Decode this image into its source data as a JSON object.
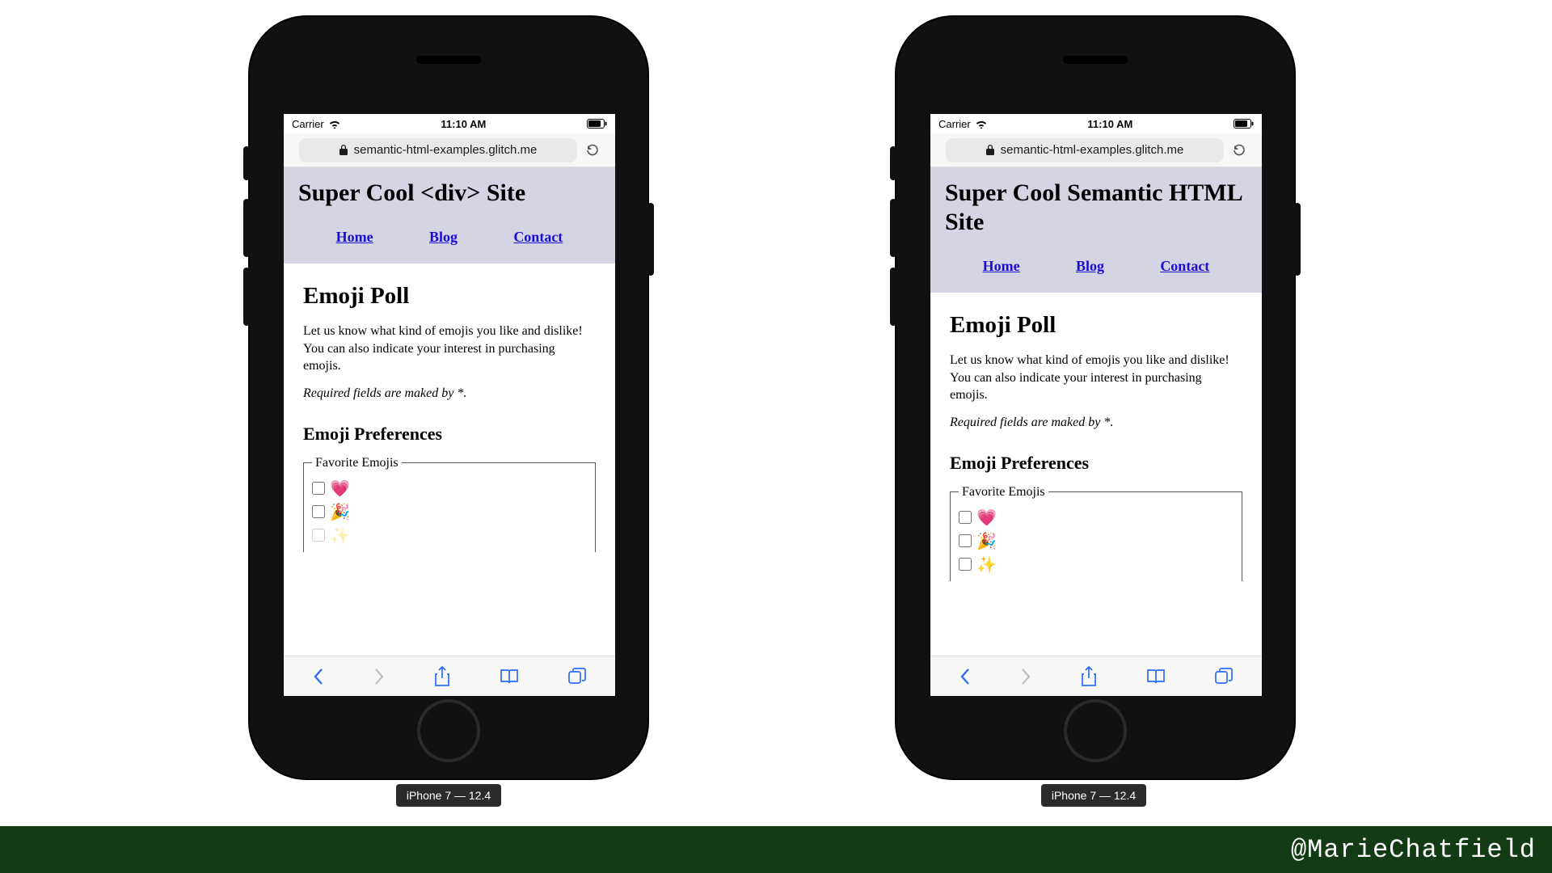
{
  "attribution": "@MarieChatfield",
  "device_label": "iPhone 7 — 12.4",
  "status": {
    "carrier": "Carrier",
    "time": "11:10 AM"
  },
  "address": {
    "url": "semantic-html-examples.glitch.me"
  },
  "nav": {
    "home": "Home",
    "blog": "Blog",
    "contact": "Contact"
  },
  "left": {
    "title": "Super Cool <div> Site"
  },
  "right": {
    "title": "Super Cool Semantic HTML Site"
  },
  "page": {
    "heading": "Emoji Poll",
    "intro": "Let us know what kind of emojis you like and dislike! You can also indicate your interest in purchasing emojis.",
    "required_note": "Required fields are maked by *.",
    "subheading": "Emoji Preferences",
    "fieldset_legend": "Favorite Emojis",
    "options": [
      "💗",
      "🎉",
      "✨"
    ]
  }
}
